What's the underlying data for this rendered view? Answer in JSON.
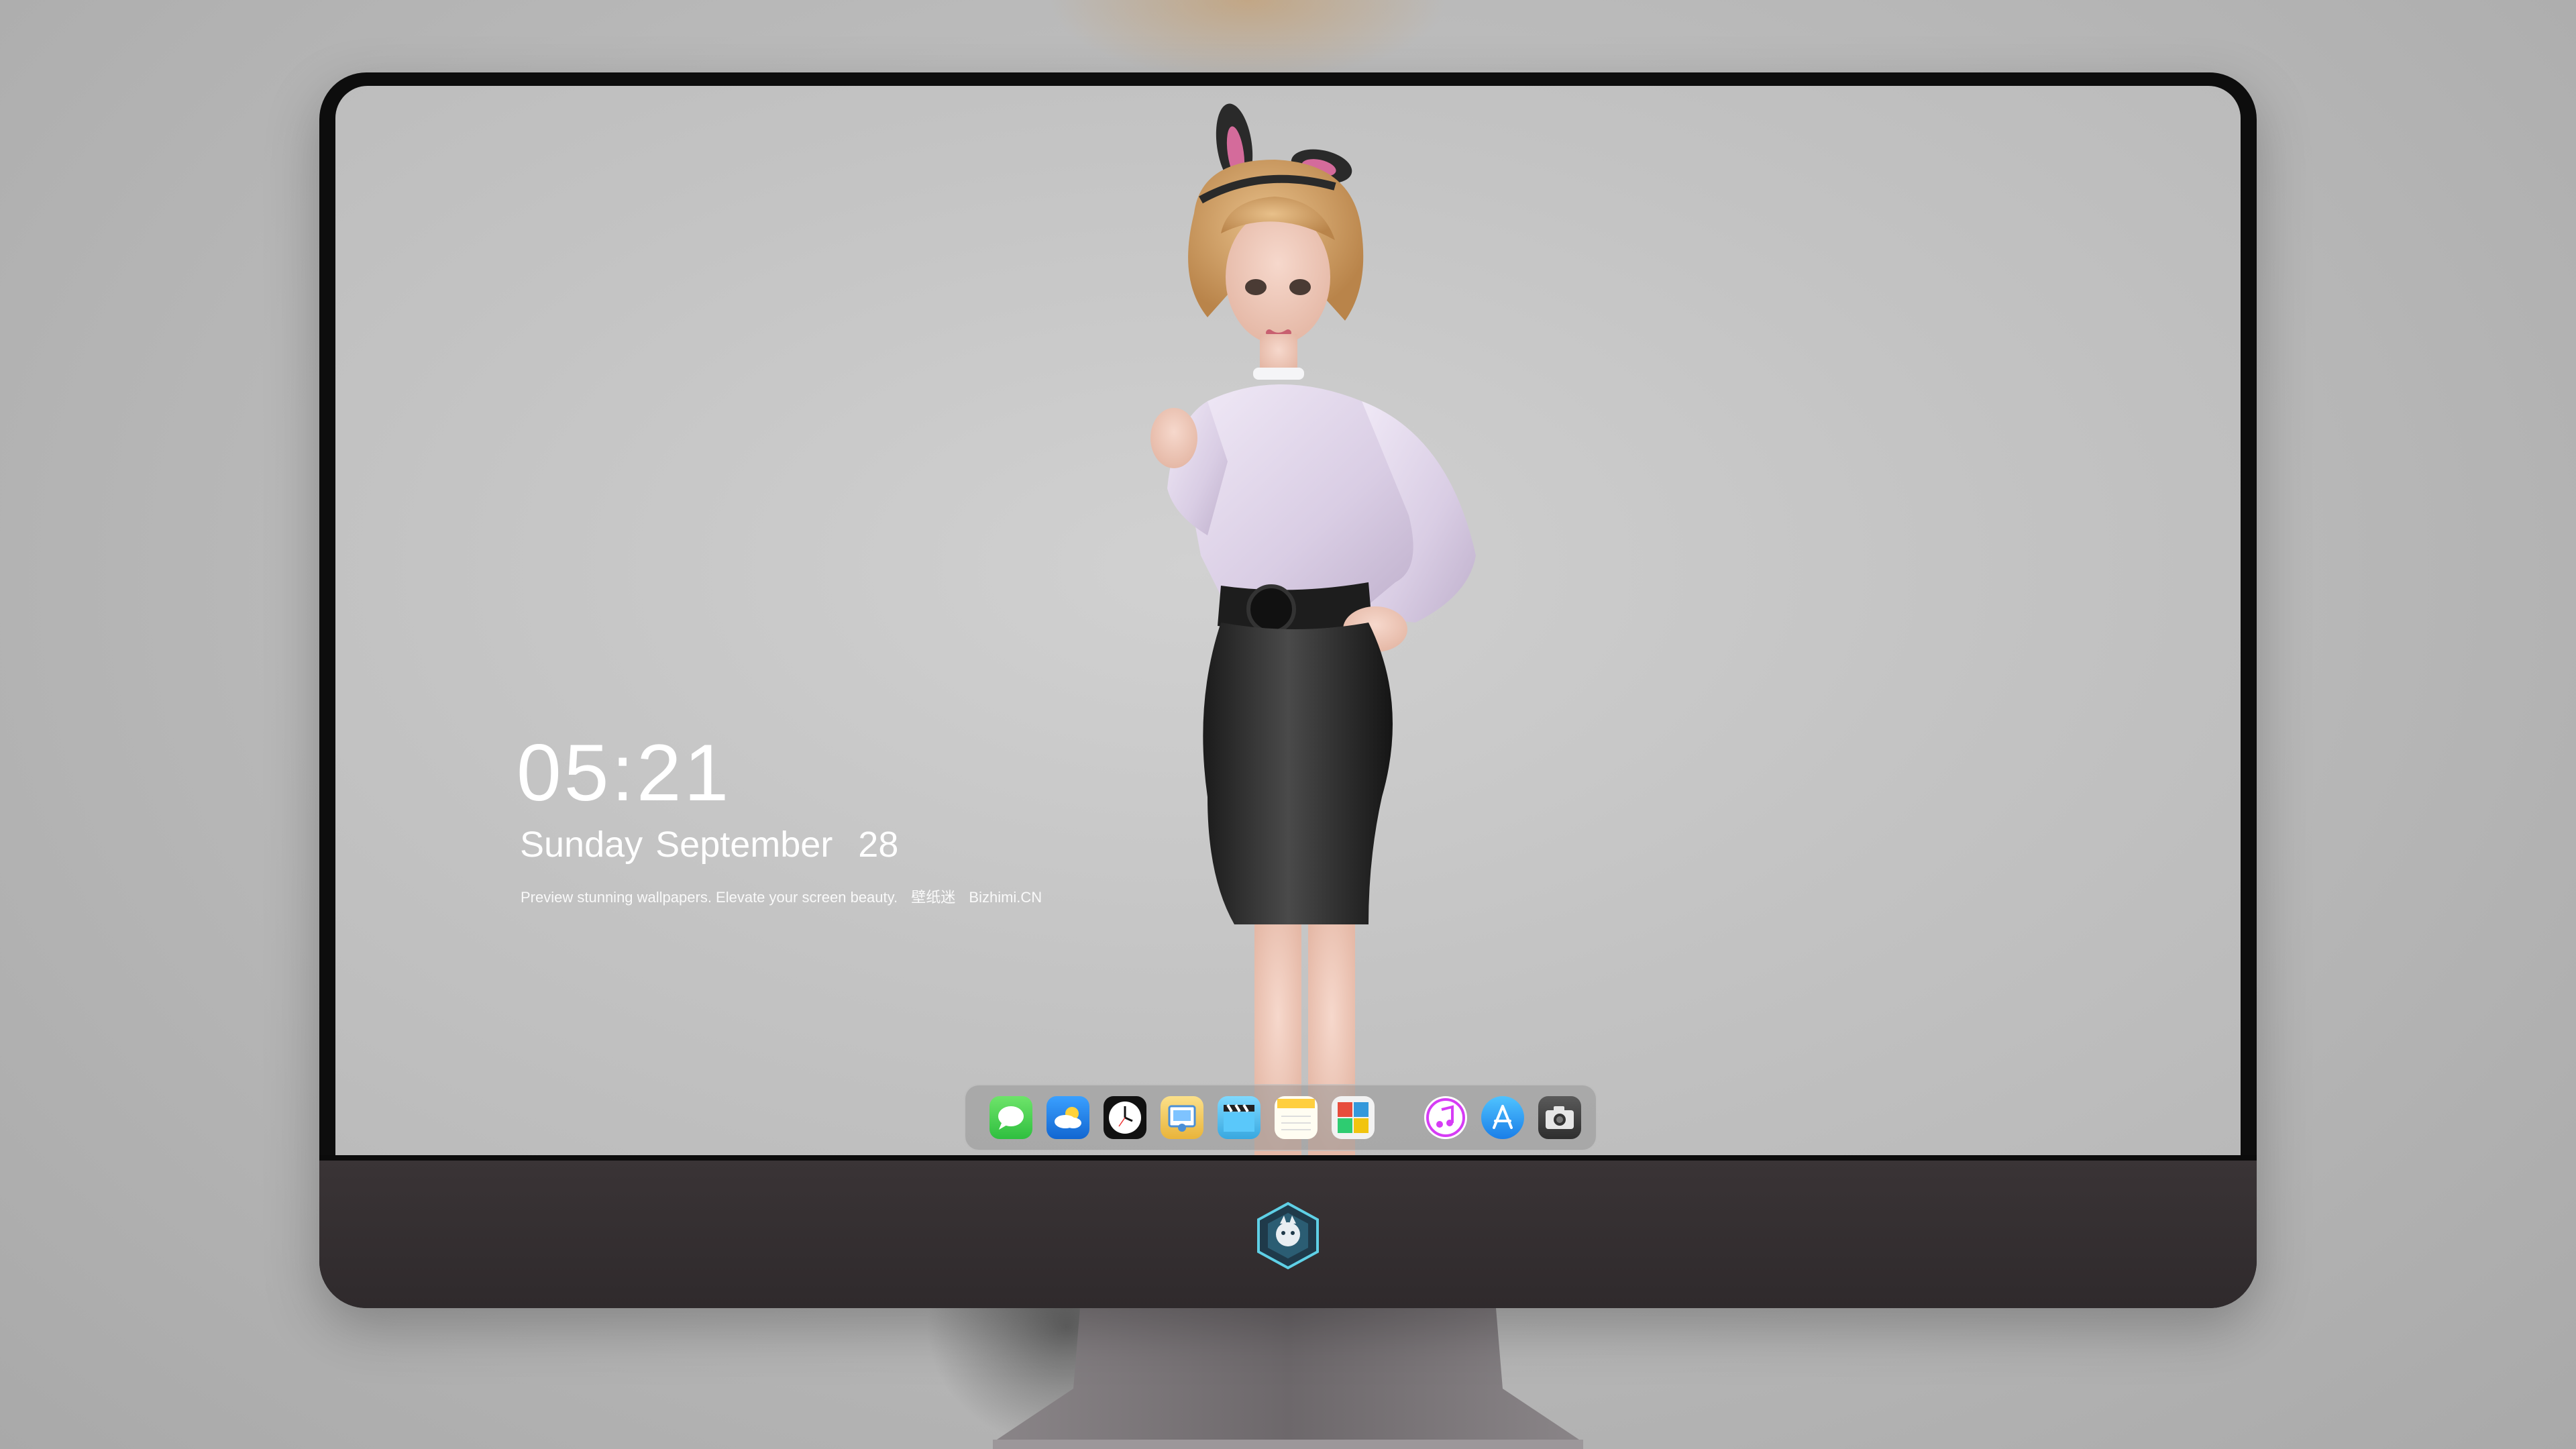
{
  "lock_screen": {
    "time": "05:21",
    "date": "Sunday September  28",
    "tagline": {
      "text": "Preview stunning wallpapers. Elevate your screen beauty.",
      "brand_cn": "壁纸迷",
      "brand": "Bizhimi.CN"
    }
  },
  "dock": {
    "apps": [
      {
        "name": "messages-icon",
        "color": "#3ed14f"
      },
      {
        "name": "weather-icon",
        "color": "#1f7fe6"
      },
      {
        "name": "clock-icon",
        "color": "#111111"
      },
      {
        "name": "preview-icon",
        "color": "#f2c94c"
      },
      {
        "name": "clips-icon",
        "color": "#5ac8fa"
      },
      {
        "name": "notes-icon",
        "color": "#ffd54a"
      },
      {
        "name": "photo-booth-icon",
        "color": "#e74c3c"
      },
      {
        "name": "music-icon",
        "color": "#d63cf5"
      },
      {
        "name": "app-store-icon",
        "color": "#2aa6f5"
      },
      {
        "name": "camera-icon",
        "color": "#3a3a3a"
      }
    ]
  },
  "colors": {
    "bezel": "#0d0d0d",
    "chin": "#332e30",
    "screen_bg": "#c6c6c6"
  }
}
